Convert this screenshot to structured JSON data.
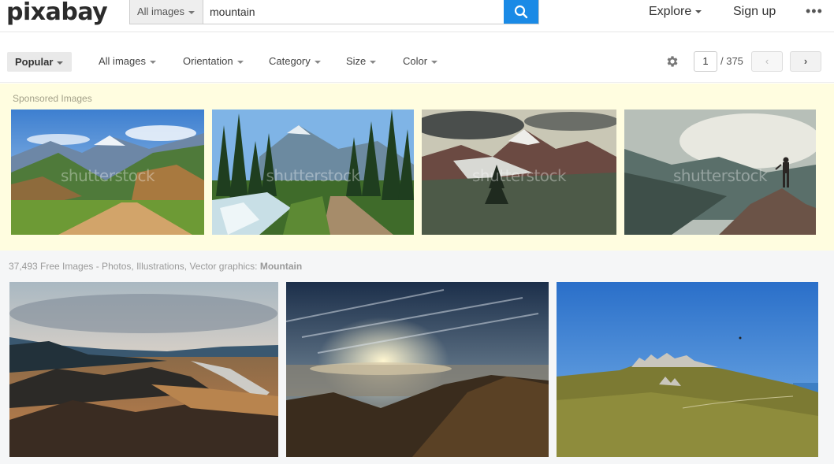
{
  "header": {
    "logo": "pixabay",
    "search_type": "All images",
    "search_value": "mountain",
    "explore": "Explore",
    "signup": "Sign up",
    "more": "•••"
  },
  "filters": {
    "popular": "Popular",
    "all_images": "All images",
    "orientation": "Orientation",
    "category": "Category",
    "size": "Size",
    "color": "Color"
  },
  "pagination": {
    "current": "1",
    "total": "/ 375",
    "prev": "‹",
    "next": "›"
  },
  "sponsored": {
    "label": "Sponsored Images",
    "watermark": "shutterstock"
  },
  "results": {
    "count_text": "37,493 Free Images - Photos, Illustrations, Vector graphics:",
    "query": "Mountain"
  },
  "colors": {
    "accent": "#1a8ae6",
    "sponsored_bg": "#fffde0",
    "results_bg": "#f5f6f7"
  }
}
